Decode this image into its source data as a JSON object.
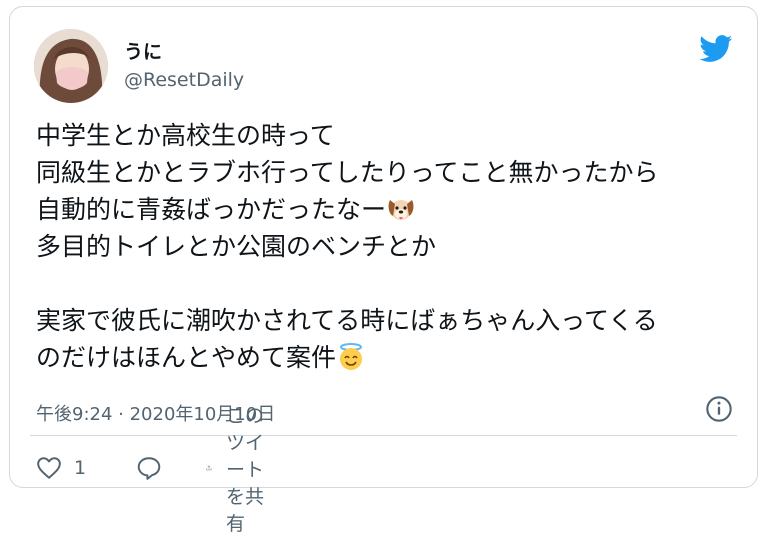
{
  "author": {
    "display_name": "うに",
    "handle": "@ResetDaily"
  },
  "tweet": {
    "lines": [
      "中学生とか高校生の時って",
      "同級生とかとラブホ行ってしたりってこと無かったから",
      "自動的に青姦ばっかだったなー",
      "多目的トイレとか公園のベンチとか",
      "",
      "実家で彼氏に潮吹かされてる時にばぁちゃん入ってくる",
      "のだけはほんとやめて案件"
    ],
    "emojis": [
      "dog-face-emoji",
      "smiling-face-with-halo-emoji"
    ]
  },
  "meta": {
    "timestamp": "午後9:24 · 2020年10月10日"
  },
  "actions": {
    "like_count": "1",
    "share_label": "このツイートを共有"
  },
  "colors": {
    "text": "#0f1419",
    "secondary": "#536471",
    "border": "#cfd9de",
    "brand": "#1d9bf0"
  }
}
